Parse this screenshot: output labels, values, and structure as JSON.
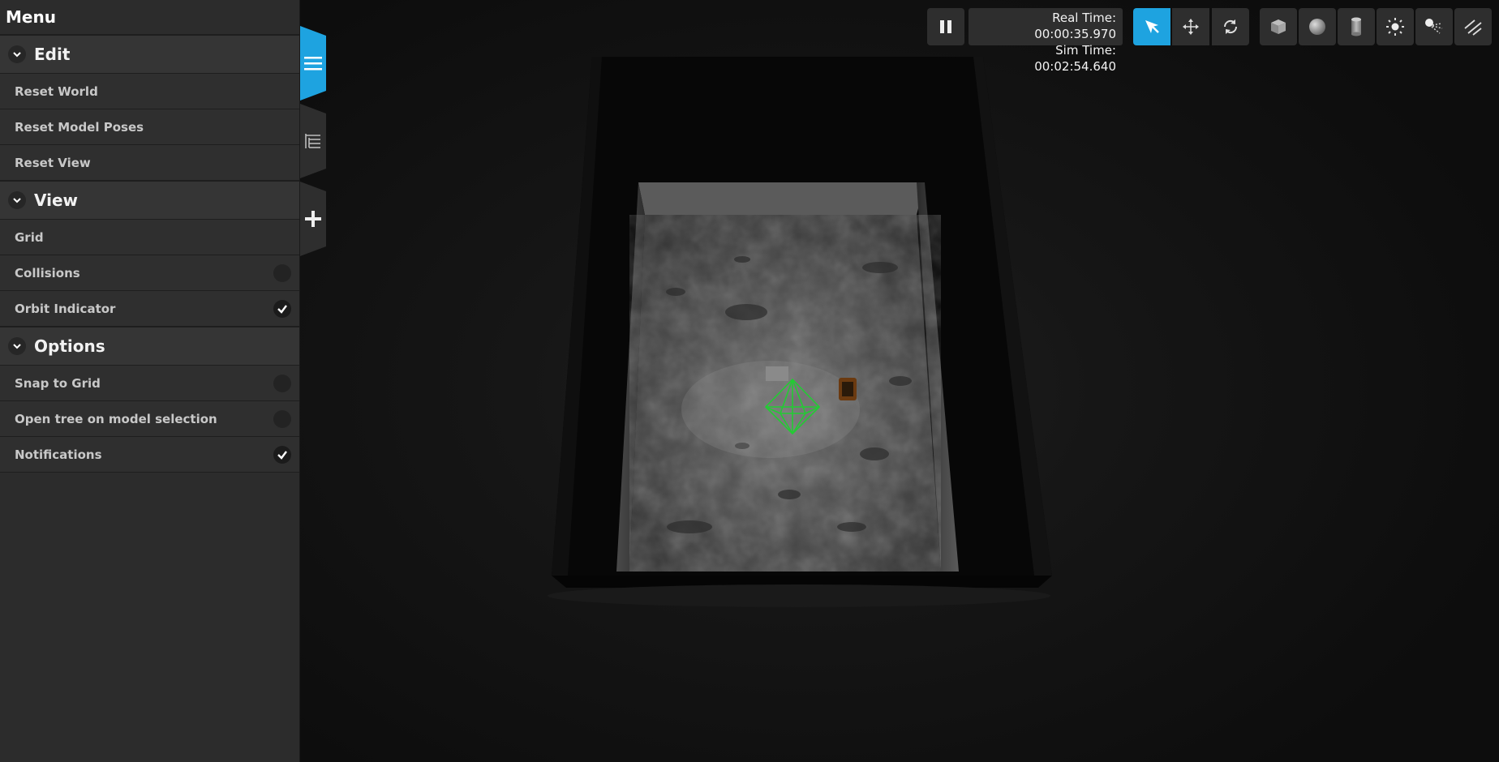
{
  "menu": {
    "title": "Menu",
    "sections": [
      {
        "title": "Edit",
        "items": [
          {
            "label": "Reset World"
          },
          {
            "label": "Reset Model Poses"
          },
          {
            "label": "Reset View"
          }
        ]
      },
      {
        "title": "View",
        "items": [
          {
            "label": "Grid",
            "toggle": "none"
          },
          {
            "label": "Collisions",
            "toggle": "off"
          },
          {
            "label": "Orbit Indicator",
            "toggle": "on"
          }
        ]
      },
      {
        "title": "Options",
        "items": [
          {
            "label": "Snap to Grid",
            "toggle": "off"
          },
          {
            "label": "Open tree on model selection",
            "toggle": "off"
          },
          {
            "label": "Notifications",
            "toggle": "on"
          }
        ]
      }
    ]
  },
  "side_tabs": [
    {
      "icon": "menu-icon",
      "active": true
    },
    {
      "icon": "tree-icon",
      "active": false
    },
    {
      "icon": "plus-icon",
      "active": false
    }
  ],
  "time": {
    "real_label": "Real Time:",
    "real_value": "00:00:35.970",
    "sim_label": "Sim Time:",
    "sim_value": "00:02:54.640"
  },
  "toolbar": {
    "pause_icon": "pause-icon",
    "modes": [
      "select-icon",
      "translate-icon",
      "rotate-icon"
    ],
    "active_mode": "select-icon",
    "shapes": [
      "box-icon",
      "sphere-icon",
      "cylinder-icon",
      "point-light-icon",
      "spot-light-icon",
      "directional-light-icon"
    ]
  },
  "colors": {
    "accent": "#1ea3e0",
    "panel_bg": "#2c2c2c",
    "orbit_indicator": "#22cc33"
  }
}
